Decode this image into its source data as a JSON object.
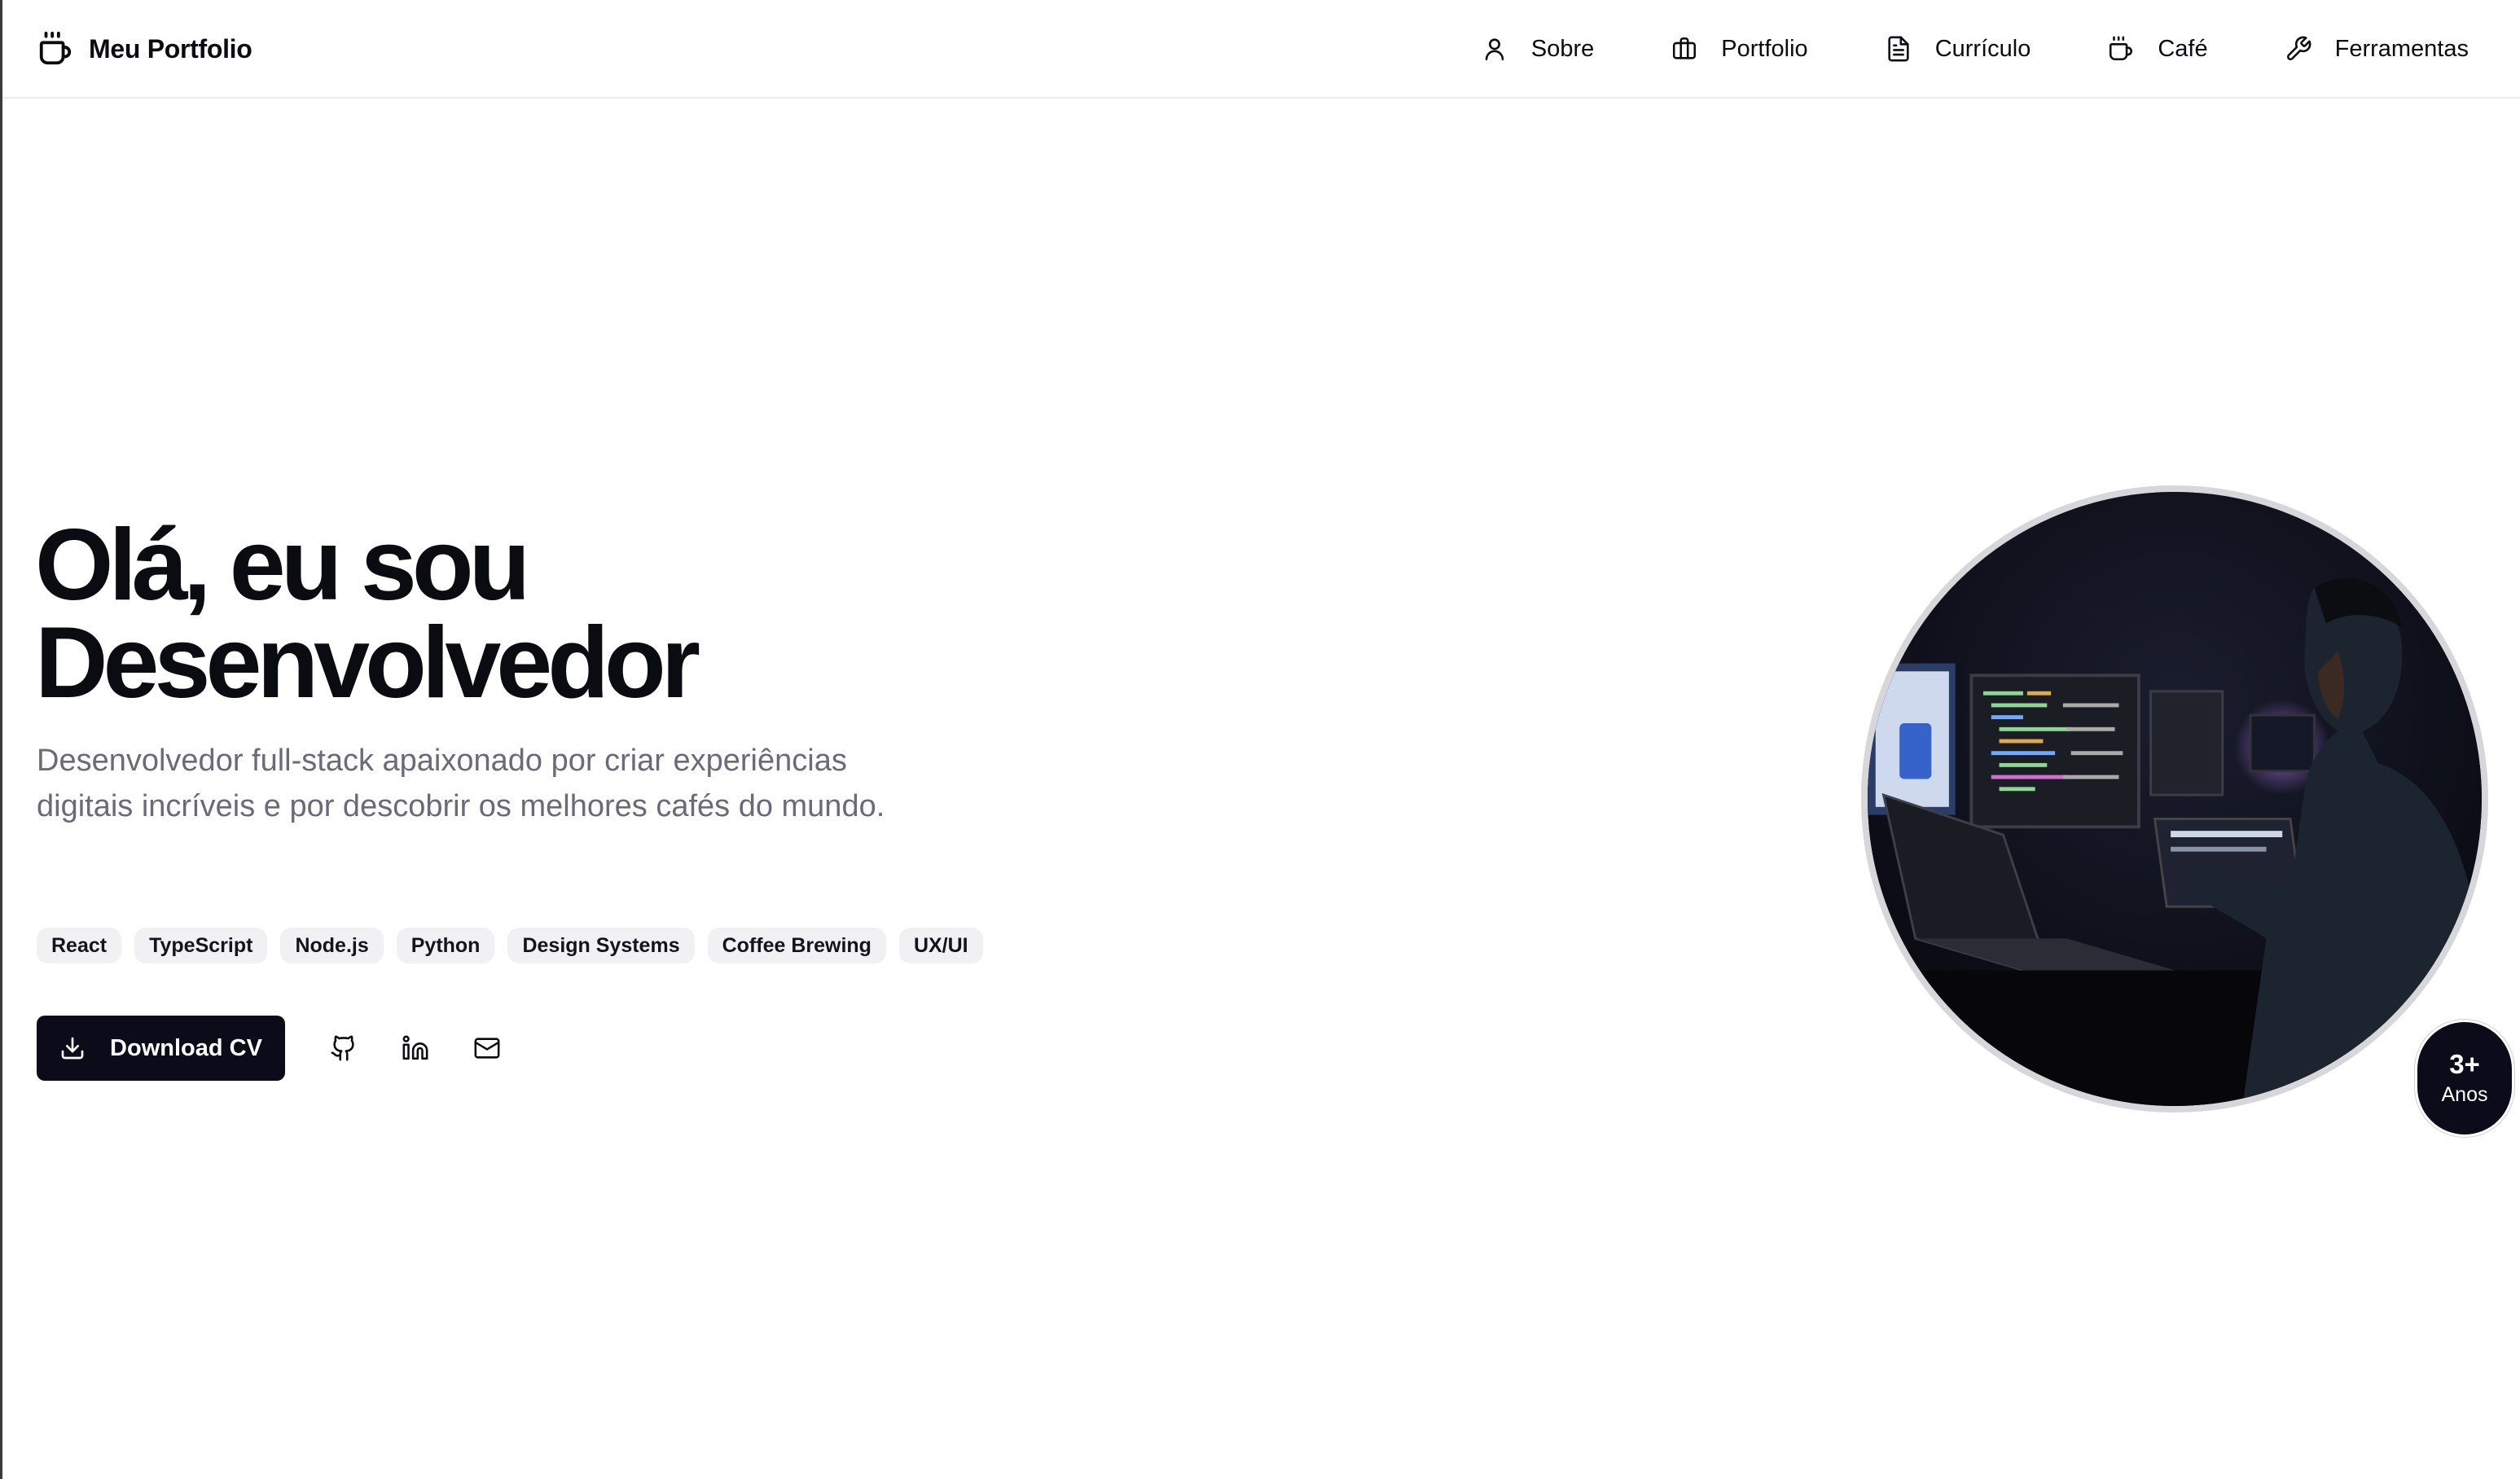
{
  "brand": {
    "name": "Meu Portfolio",
    "icon": "coffee-cup-icon"
  },
  "nav": [
    {
      "label": "Sobre",
      "icon": "user-icon"
    },
    {
      "label": "Portfolio",
      "icon": "briefcase-icon"
    },
    {
      "label": "Currículo",
      "icon": "document-icon"
    },
    {
      "label": "Café",
      "icon": "coffee-icon"
    },
    {
      "label": "Ferramentas",
      "icon": "wrench-icon"
    }
  ],
  "hero": {
    "title_line1": "Olá, eu sou",
    "title_line2": "Desenvolvedor",
    "subtitle": "Desenvolvedor full-stack apaixonado por criar experiências digitais incríveis e por descobrir os melhores cafés do mundo.",
    "tags": [
      "React",
      "TypeScript",
      "Node.js",
      "Python",
      "Design Systems",
      "Coffee Brewing",
      "UX/UI"
    ],
    "download_label": "Download CV",
    "social": [
      "github-icon",
      "linkedin-icon",
      "mail-icon"
    ]
  },
  "badge": {
    "value": "3+",
    "label": "Anos"
  },
  "colors": {
    "primary": "#0b0b1a",
    "muted_text": "#6b6b78",
    "tag_bg": "#f1f1f4",
    "ring": "#d7d7db"
  }
}
